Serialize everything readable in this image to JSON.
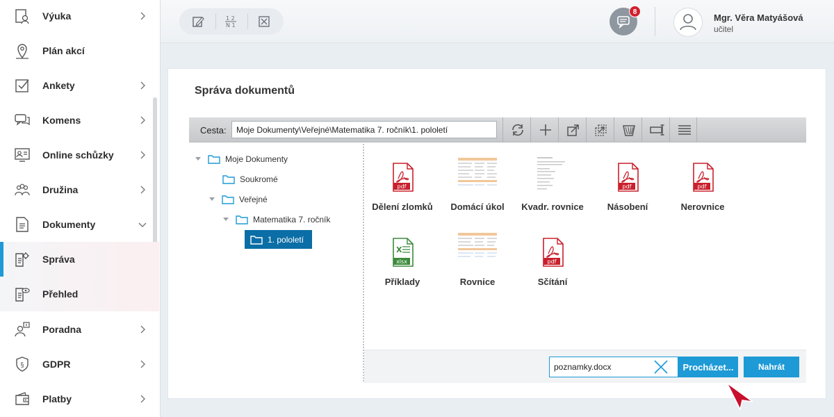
{
  "sidebar": {
    "items": [
      {
        "label": "Výuka",
        "icon": "book-person-icon",
        "chevron": "right"
      },
      {
        "label": "Plán akcí",
        "icon": "map-pin-icon",
        "chevron": ""
      },
      {
        "label": "Ankety",
        "icon": "checkbox-icon",
        "chevron": "right"
      },
      {
        "label": "Komens",
        "icon": "chat-bubbles-icon",
        "chevron": "right"
      },
      {
        "label": "Online schůzky",
        "icon": "video-meeting-icon",
        "chevron": "right"
      },
      {
        "label": "Družina",
        "icon": "group-people-icon",
        "chevron": "right"
      },
      {
        "label": "Dokumenty",
        "icon": "document-icon",
        "chevron": "down"
      },
      {
        "label": "Správa",
        "icon": "document-gear-icon",
        "chevron": ""
      },
      {
        "label": "Přehled",
        "icon": "document-eye-icon",
        "chevron": ""
      },
      {
        "label": "Poradna",
        "icon": "person-info-icon",
        "chevron": "right"
      },
      {
        "label": "GDPR",
        "icon": "shield-paragraph-icon",
        "chevron": "right"
      },
      {
        "label": "Platby",
        "icon": "wallet-icon",
        "chevron": "right"
      }
    ],
    "active_index": 7,
    "accent": "#1e9ad6"
  },
  "topbar": {
    "tools": [
      "edit-note-icon",
      "fraction-grades-icon",
      "close-box-icon"
    ],
    "messages_badge": "8",
    "user_name": "Mgr. Věra Matyášová",
    "user_role": "učitel"
  },
  "card": {
    "title": "Správa dokumentů",
    "path_label": "Cesta:",
    "path_value": "Moje Dokumenty\\Veřejné\\Matematika 7. ročník\\1. pololetí",
    "toolbar_icons": [
      "refresh-icon",
      "add-icon",
      "export-icon",
      "copy-move-icon",
      "delete-basket-icon",
      "rename-icon",
      "list-view-icon"
    ]
  },
  "tree": [
    {
      "label": "Moje Dokumenty",
      "level": 0,
      "expanded": true
    },
    {
      "label": "Soukromé",
      "level": 1,
      "expanded": false
    },
    {
      "label": "Veřejné",
      "level": 1,
      "expanded": true
    },
    {
      "label": "Matematika 7. ročník",
      "level": 2,
      "expanded": true
    },
    {
      "label": "1. pololetí",
      "level": 3,
      "expanded": false,
      "selected": true
    }
  ],
  "files": [
    {
      "name": "Dělení zlomků",
      "type": "pdf"
    },
    {
      "name": "Domácí úkol",
      "type": "sheet-thumb"
    },
    {
      "name": "Kvadr. rovnice",
      "type": "doc-thumb"
    },
    {
      "name": "Násobení",
      "type": "pdf"
    },
    {
      "name": "Nerovnice",
      "type": "pdf"
    },
    {
      "name": "Příklady",
      "type": "xlsx"
    },
    {
      "name": "Rovnice",
      "type": "sheet-thumb"
    },
    {
      "name": "Sčítání",
      "type": "pdf"
    }
  ],
  "file_type_labels": {
    "pdf": "pdf",
    "xlsx": "xlsx"
  },
  "upload": {
    "file_value": "poznamky.docx",
    "browse_label": "Procházet...",
    "upload_label": "Nahrát"
  },
  "colors": {
    "pdf_red": "#c8202c",
    "xlsx_green": "#3c8a3c",
    "selected_tree": "#0b6ea6"
  }
}
